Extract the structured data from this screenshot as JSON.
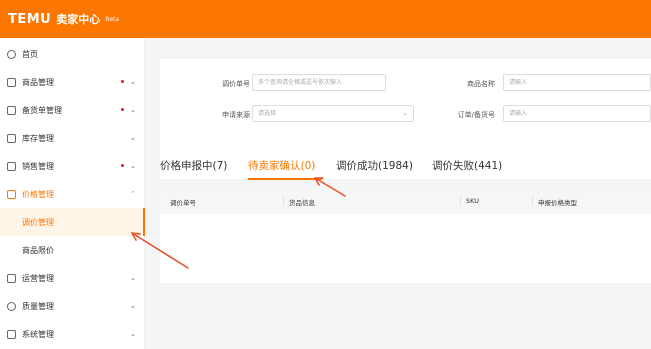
{
  "topbar": {
    "logo": "TEMU",
    "title": "卖家中心",
    "badge": "Beta"
  },
  "sidebar": {
    "items": [
      {
        "label": "首页",
        "icon": "home-icon"
      },
      {
        "label": "商品管理",
        "icon": "product-icon",
        "dot": true
      },
      {
        "label": "备货单管理",
        "icon": "order-icon",
        "dot": true
      },
      {
        "label": "库存管理",
        "icon": "inventory-icon"
      },
      {
        "label": "销售管理",
        "icon": "sales-icon",
        "dot": true
      },
      {
        "label": "价格管理",
        "icon": "price-icon",
        "expanded": true
      },
      {
        "label": "调价管理",
        "sub": true,
        "selected": true
      },
      {
        "label": "商品限价",
        "sub": true
      },
      {
        "label": "运营管理",
        "icon": "operations-icon"
      },
      {
        "label": "质量管理",
        "icon": "quality-icon"
      },
      {
        "label": "系统管理",
        "icon": "system-icon"
      }
    ]
  },
  "filters": {
    "adjust_no_label": "调价单号",
    "adjust_no_placeholder": "多个查询请全格或逗号依次输入",
    "product_name_label": "商品名称",
    "product_name_placeholder": "请输入",
    "source_label": "申请来源",
    "source_placeholder": "请选择",
    "order_no_label": "订单/备货号",
    "order_no_placeholder": "请输入"
  },
  "tabs": [
    {
      "label": "价格申报中(7)"
    },
    {
      "label": "待卖家确认(0)",
      "active": true
    },
    {
      "label": "调价成功(1984)"
    },
    {
      "label": "调价失败(441)"
    }
  ],
  "table": {
    "columns": [
      "调价单号",
      "货品信息",
      "SKU",
      "申报价格类型"
    ]
  },
  "colors": {
    "accent": "#fb7701",
    "annotation_arrow": "#e8532c"
  }
}
